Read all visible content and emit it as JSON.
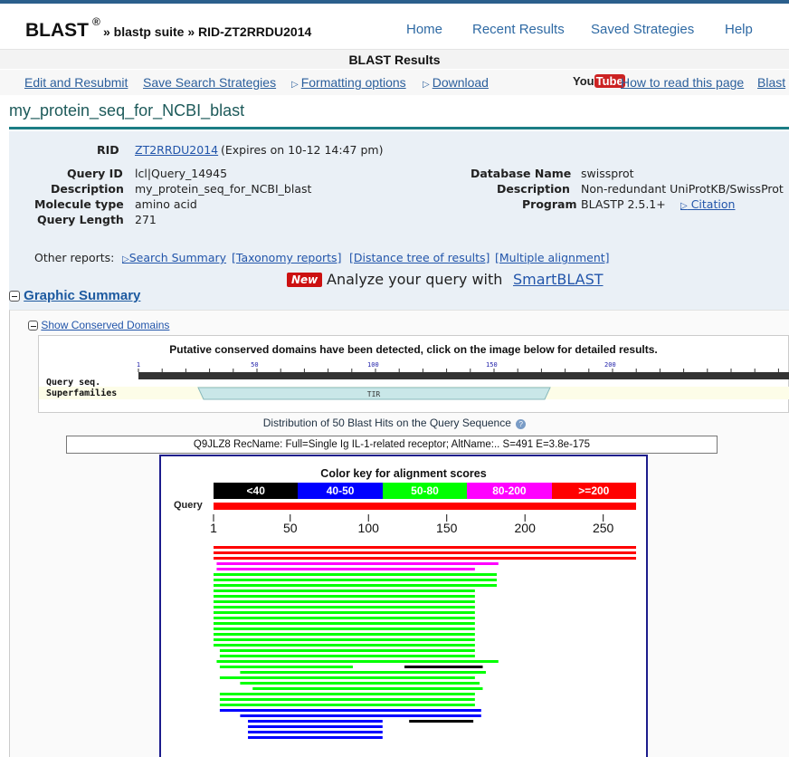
{
  "header": {
    "brand": "BLAST",
    "registered": "®",
    "breadcrumb": "» blastp suite » RID-ZT2RRDU2014",
    "nav": [
      "Home",
      "Recent Results",
      "Saved Strategies",
      "Help"
    ]
  },
  "results_bar": "BLAST Results",
  "toolbar": {
    "edit": "Edit and Resubmit",
    "save": "Save Search Strategies",
    "formatting": "Formatting options",
    "download": "Download",
    "youtube_you": "You",
    "youtube_tube": "Tube",
    "howto": "How to read this page",
    "blast_cut": "Blast"
  },
  "job_title": "my_protein_seq_for_NCBI_blast",
  "info": {
    "rid_label": "RID",
    "rid_value": "ZT2RRDU2014",
    "rid_expires": "(Expires on 10-12 14:47 pm)",
    "query_id_label": "Query ID",
    "query_id": "lcl|Query_14945",
    "description_label": "Description",
    "description": "my_protein_seq_for_NCBI_blast",
    "molecule_label": "Molecule type",
    "molecule": "amino acid",
    "length_label": "Query Length",
    "length": "271",
    "db_label": "Database Name",
    "db": "swissprot",
    "db_desc_label": "Description",
    "db_desc": "Non-redundant UniProtKB/SwissProt",
    "program_label": "Program",
    "program": "BLASTP 2.5.1+",
    "citation": "Citation"
  },
  "other_reports": {
    "label": "Other reports:",
    "search_summary": "Search Summary",
    "taxonomy": "[Taxonomy reports]",
    "distance": "[Distance tree of results]",
    "multiple": "[Multiple alignment]"
  },
  "smartblast": {
    "badge": "New",
    "text": "Analyze your query with",
    "link": "SmartBLAST"
  },
  "graphic_summary": "Graphic Summary",
  "cdd": {
    "toggle": "Show Conserved Domains",
    "message": "Putative conserved domains have been detected, click on the image below for detailed results.",
    "query_label": "Query seq.",
    "superfamilies_label": "Superfamilies",
    "ticks": [
      "1",
      "50",
      "100",
      "150",
      "200"
    ],
    "domain": "TIR"
  },
  "distribution": {
    "title": "Distribution of 50 Blast Hits on the Query Sequence",
    "hit_description": "Q9JLZ8 RecName: Full=Single Ig IL-1-related receptor; AltName:.. S=491 E=3.8e-175",
    "key_title": "Color key for alignment scores",
    "key": [
      {
        "label": "<40",
        "color": "#000000"
      },
      {
        "label": "40-50",
        "color": "#0000ff"
      },
      {
        "label": "50-80",
        "color": "#00ff00"
      },
      {
        "label": "80-200",
        "color": "#ff00ff"
      },
      {
        "label": ">=200",
        "color": "#ff0000"
      }
    ],
    "query_label": "Query",
    "axis_ticks": [
      "1",
      "50",
      "100",
      "150",
      "200",
      "250"
    ]
  },
  "chart_data": {
    "type": "bar",
    "title": "Distribution of 50 Blast Hits on the Query Sequence",
    "xlim": [
      1,
      271
    ],
    "hits": [
      {
        "start": 1,
        "end": 271,
        "color": "#ff0000"
      },
      {
        "start": 1,
        "end": 271,
        "color": "#ff0000"
      },
      {
        "start": 1,
        "end": 271,
        "color": "#ff0000"
      },
      {
        "start": 3,
        "end": 183,
        "color": "#ff00ff"
      },
      {
        "start": 3,
        "end": 168,
        "color": "#ff00ff"
      },
      {
        "start": 1,
        "end": 182,
        "color": "#00ff00"
      },
      {
        "start": 1,
        "end": 182,
        "color": "#00ff00"
      },
      {
        "start": 1,
        "end": 182,
        "color": "#00ff00"
      },
      {
        "start": 1,
        "end": 168,
        "color": "#00ff00"
      },
      {
        "start": 1,
        "end": 168,
        "color": "#00ff00"
      },
      {
        "start": 1,
        "end": 168,
        "color": "#00ff00"
      },
      {
        "start": 1,
        "end": 168,
        "color": "#00ff00"
      },
      {
        "start": 1,
        "end": 168,
        "color": "#00ff00"
      },
      {
        "start": 1,
        "end": 168,
        "color": "#00ff00"
      },
      {
        "start": 1,
        "end": 168,
        "color": "#00ff00"
      },
      {
        "start": 1,
        "end": 168,
        "color": "#00ff00"
      },
      {
        "start": 1,
        "end": 168,
        "color": "#00ff00"
      },
      {
        "start": 1,
        "end": 168,
        "color": "#00ff00"
      },
      {
        "start": 1,
        "end": 168,
        "color": "#00ff00"
      },
      {
        "start": 5,
        "end": 168,
        "color": "#00ff00"
      },
      {
        "start": 5,
        "end": 168,
        "color": "#00ff00"
      },
      {
        "start": 3,
        "end": 183,
        "color": "#00ff00"
      },
      {
        "start": 5,
        "end": 90,
        "color": "#00ff00"
      },
      {
        "start": 123,
        "end": 173,
        "color": "#000000"
      },
      {
        "start": 18,
        "end": 175,
        "color": "#00ff00"
      },
      {
        "start": 5,
        "end": 168,
        "color": "#00ff00"
      },
      {
        "start": 18,
        "end": 171,
        "color": "#00ff00"
      },
      {
        "start": 26,
        "end": 173,
        "color": "#00ff00"
      },
      {
        "start": 5,
        "end": 168,
        "color": "#00ff00"
      },
      {
        "start": 5,
        "end": 168,
        "color": "#00ff00"
      },
      {
        "start": 5,
        "end": 168,
        "color": "#00ff00"
      },
      {
        "start": 5,
        "end": 172,
        "color": "#0000ff"
      },
      {
        "start": 18,
        "end": 172,
        "color": "#0000ff"
      },
      {
        "start": 23,
        "end": 109,
        "color": "#0000ff"
      },
      {
        "start": 126,
        "end": 167,
        "color": "#000000"
      },
      {
        "start": 23,
        "end": 109,
        "color": "#0000ff"
      },
      {
        "start": 23,
        "end": 109,
        "color": "#0000ff"
      },
      {
        "start": 23,
        "end": 109,
        "color": "#0000ff"
      }
    ]
  }
}
